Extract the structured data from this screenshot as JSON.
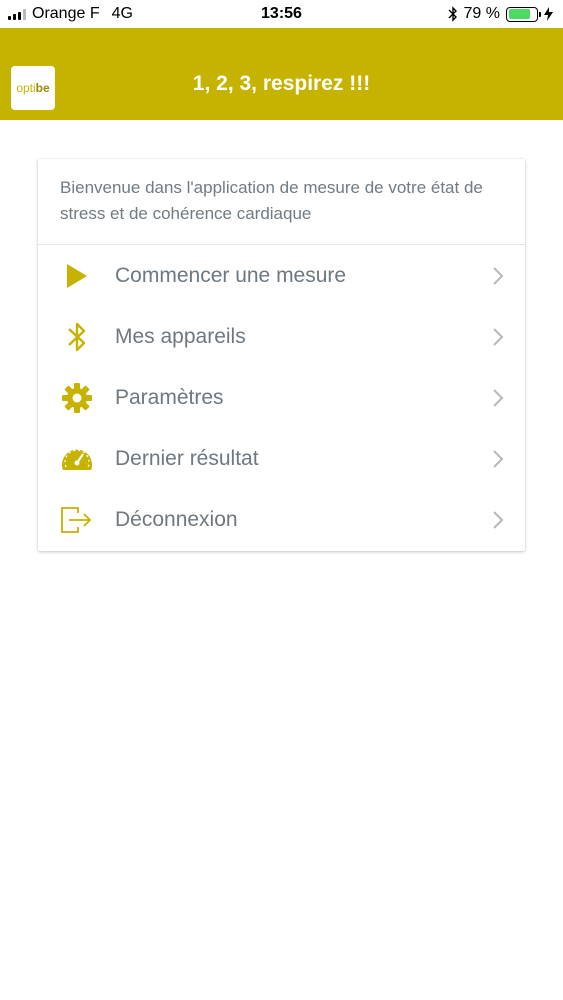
{
  "status_bar": {
    "carrier": "Orange F",
    "network": "4G",
    "time": "13:56",
    "battery": "79 %",
    "battery_level": 0.79
  },
  "header": {
    "logo_text_1": "opti",
    "logo_text_2": "be",
    "title": "1, 2, 3, respirez !!!"
  },
  "card": {
    "welcome": "Bienvenue dans l'application de mesure de votre état de stress et de cohérence cardiaque",
    "menu": [
      {
        "label": "Commencer une mesure",
        "icon": "play-icon"
      },
      {
        "label": "Mes appareils",
        "icon": "bluetooth-icon"
      },
      {
        "label": "Paramètres",
        "icon": "gear-icon"
      },
      {
        "label": "Dernier résultat",
        "icon": "gauge-icon"
      },
      {
        "label": "Déconnexion",
        "icon": "logout-icon"
      }
    ]
  },
  "colors": {
    "accent": "#c6b300",
    "text": "#6e7880",
    "chevron": "#b8b8b8"
  }
}
